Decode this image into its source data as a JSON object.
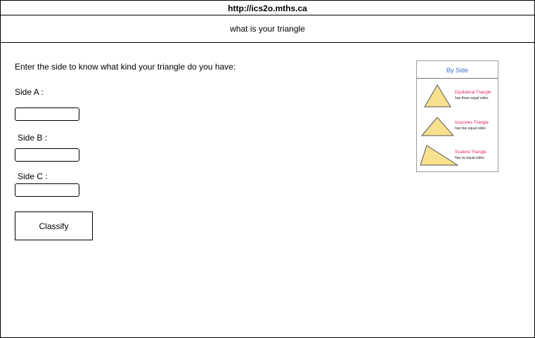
{
  "browser": {
    "url": "http://ics2o.mths.ca"
  },
  "page": {
    "title": "what  is your triangle"
  },
  "form": {
    "intro": "Enter the side to know what kind your triangle do you have:",
    "side_a_label": "Side A :",
    "side_b_label": "Side B :",
    "side_c_label": "Side C :",
    "side_a_value": "",
    "side_b_value": "",
    "side_c_value": "",
    "classify_label": "Classify"
  },
  "reference": {
    "heading": "By Side",
    "items": [
      {
        "name": "Equilateral Triangle",
        "desc": "has three equal sides"
      },
      {
        "name": "Isosceles Triangle",
        "desc": "has two equal sides"
      },
      {
        "name": "Scalene Triangle",
        "desc": "has no equal sides"
      }
    ],
    "colors": {
      "fill": "#f8e08e",
      "name_text": "#e0245e",
      "heading_text": "#3a6fc4"
    }
  }
}
